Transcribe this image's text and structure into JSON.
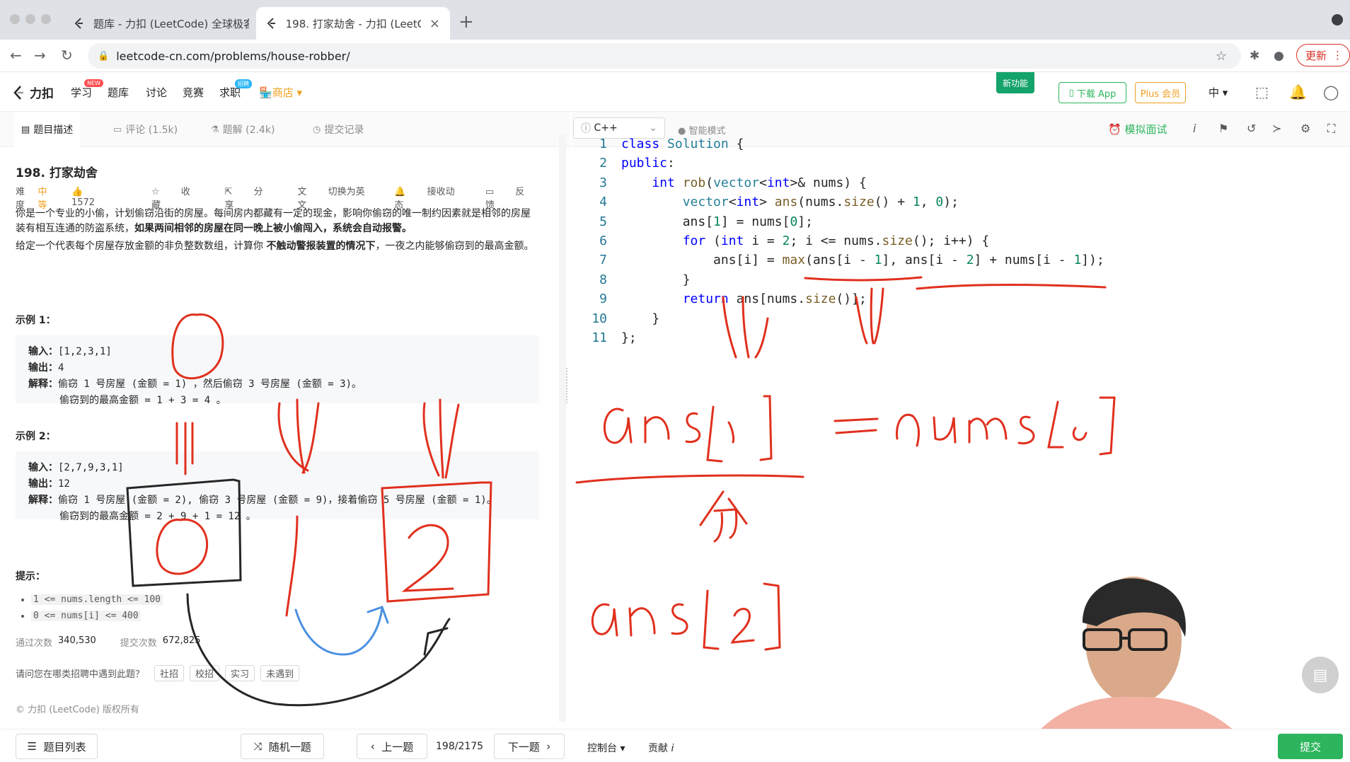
{
  "browser": {
    "tabs": [
      {
        "title": "题库 - 力扣 (LeetCode) 全球极客…",
        "active": false
      },
      {
        "title": "198. 打家劫舍 - 力扣 (LeetCode)",
        "active": true
      }
    ],
    "url": "leetcode-cn.com/problems/house-robber/",
    "update_label": "更新"
  },
  "sitenav": {
    "logo": "力扣",
    "links": [
      "学习",
      "题库",
      "讨论",
      "竞赛",
      "求职"
    ],
    "badge_new": "NEW",
    "badge_hire": "招聘",
    "shop": "商店",
    "new_feature": "新功能",
    "download": "下载 App",
    "plus": "Plus 会员",
    "lang": "中"
  },
  "left_tabs": [
    {
      "label": "题目描述",
      "icon": "document-icon"
    },
    {
      "label": "评论 (1.5k)",
      "icon": "comment-icon"
    },
    {
      "label": "题解 (2.4k)",
      "icon": "flask-icon"
    },
    {
      "label": "提交记录",
      "icon": "clock-icon"
    }
  ],
  "problem": {
    "title": "198. 打家劫舍",
    "difficulty_label": "难度",
    "difficulty": "中等",
    "likes": "1572",
    "favorite": "收藏",
    "share": "分享",
    "switch_lang": "切换为英文",
    "subscribe": "接收动态",
    "feedback": "反馈",
    "para1": "你是一个专业的小偷，计划偷窃沿街的房屋。每间房内都藏有一定的现金，影响你偷窃的唯一制约因素就是相邻的房屋装有相互连通的防盗系统，",
    "para1_bold": "如果两间相邻的房屋在同一晚上被小偷闯入，系统会自动报警。",
    "para2_a": "给定一个代表每个房屋存放金额的非负整数数组，计算你 ",
    "para2_bold": "不触动警报装置的情况下",
    "para2_b": "，一夜之内能够偷窃到的最高金额。",
    "example1_title": "示例 1：",
    "example1": {
      "input_label": "输入：",
      "input": "[1,2,3,1]",
      "output_label": "输出：",
      "output": "4",
      "explain_label": "解释：",
      "explain1": "偷窃 1 号房屋 (金额 = 1) ，然后偷窃 3 号房屋 (金额 = 3)。",
      "explain2": "偷窃到的最高金额 = 1 + 3 = 4 。"
    },
    "example2_title": "示例 2：",
    "example2": {
      "input_label": "输入：",
      "input": "[2,7,9,3,1]",
      "output_label": "输出：",
      "output": "12",
      "explain_label": "解释：",
      "explain1": "偷窃 1 号房屋 (金额 = 2), 偷窃 3 号房屋 (金额 = 9)，接着偷窃 5 号房屋 (金额 = 1)。",
      "explain2": "偷窃到的最高金额 = 2 + 9 + 1 = 12 。"
    },
    "hints_title": "提示：",
    "hints": [
      "1 <= nums.length <= 100",
      "0 <= nums[i] <= 400"
    ],
    "accepted_label": "通过次数",
    "accepted": "340,530",
    "submissions_label": "提交次数",
    "submissions": "672,825",
    "survey_q": "请问您在哪类招聘中遇到此题？",
    "survey_options": [
      "社招",
      "校招",
      "实习",
      "未遇到"
    ],
    "copyright": "© 力扣 (LeetCode) 版权所有"
  },
  "editor": {
    "language": "C++",
    "smart_mode": "智能模式",
    "mock_interview": "模拟面试"
  },
  "bottom": {
    "problem_list": "题目列表",
    "random": "随机一题",
    "prev": "上一题",
    "counter": "198/2175",
    "next": "下一题",
    "console": "控制台",
    "contribute": "贡献",
    "submit": "提交"
  },
  "colors": {
    "accent_green": "#2db55d",
    "medium_orange": "#f0a020",
    "annotation_red": "#e0301e",
    "annotation_blue": "#4a90e2"
  }
}
